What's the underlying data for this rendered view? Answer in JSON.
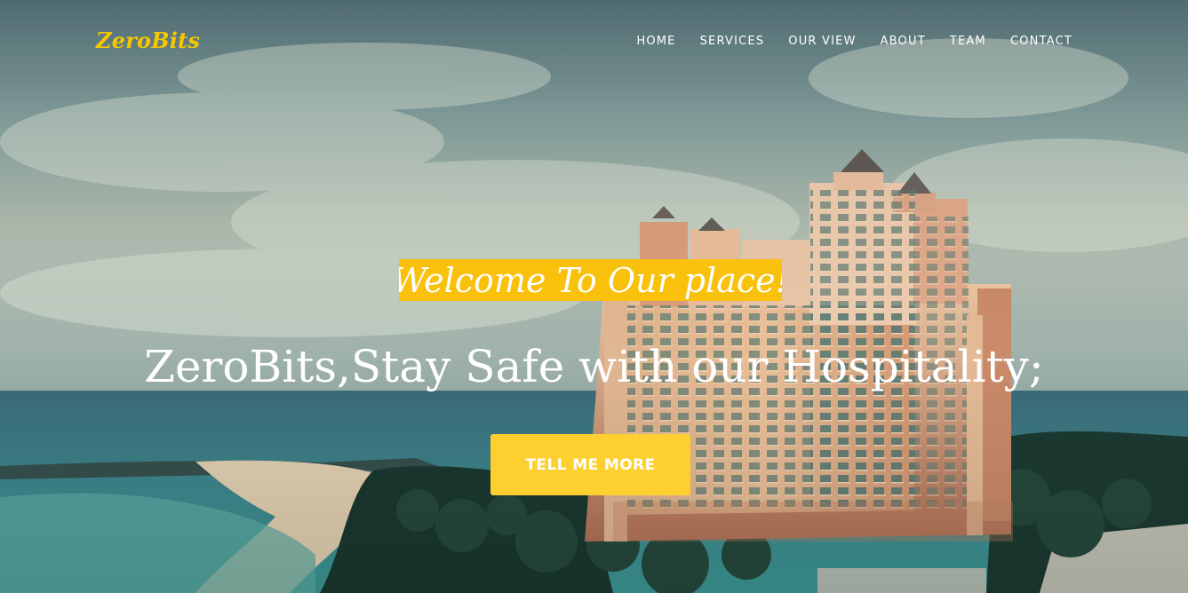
{
  "brand": {
    "name": "ZeroBits"
  },
  "nav": {
    "items": [
      {
        "label": "HOME"
      },
      {
        "label": "SERVICES"
      },
      {
        "label": "OUR VIEW"
      },
      {
        "label": "ABOUT"
      },
      {
        "label": "TEAM"
      },
      {
        "label": "CONTACT"
      }
    ]
  },
  "hero": {
    "welcome": "Welcome To Our place!",
    "headline": "ZeroBits,Stay Safe with our Hospitality;",
    "cta_label": "TELL ME MORE"
  },
  "colors": {
    "accent": "#f9c10b",
    "button": "#fdd02f",
    "text": "#ffffff"
  }
}
